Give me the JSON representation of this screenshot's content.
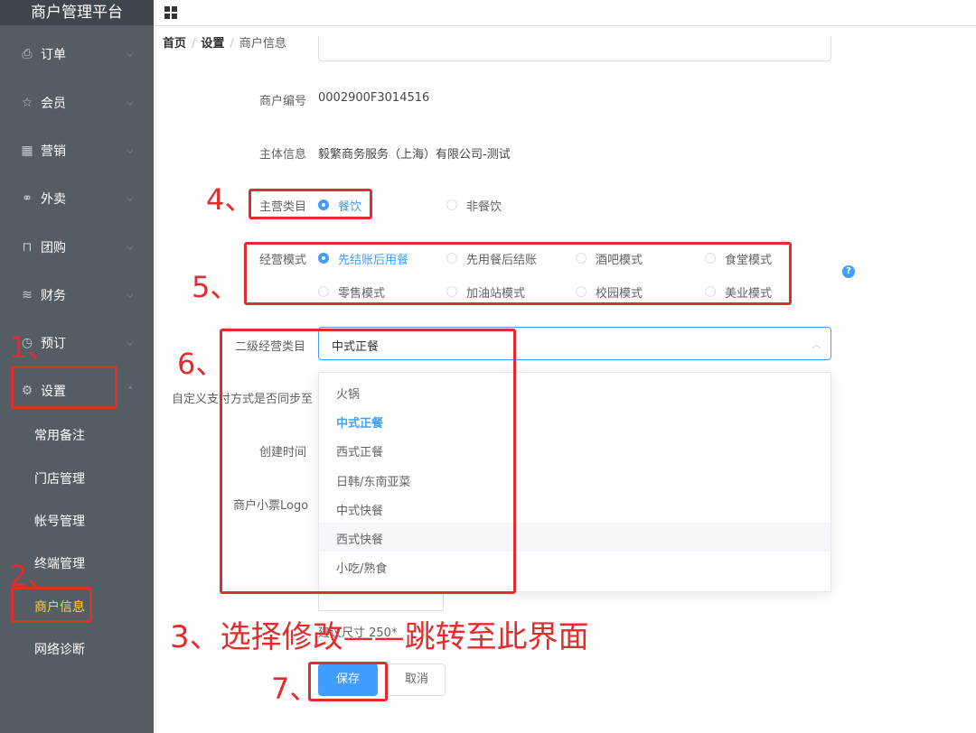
{
  "app": {
    "title": "商户管理平台"
  },
  "sidebar": {
    "menus": [
      {
        "label": "订单",
        "icon": "printer-icon"
      },
      {
        "label": "会员",
        "icon": "star-icon"
      },
      {
        "label": "营销",
        "icon": "grid-icon"
      },
      {
        "label": "外卖",
        "icon": "bike-icon"
      },
      {
        "label": "团购",
        "icon": "bag-icon"
      },
      {
        "label": "财务",
        "icon": "database-icon"
      },
      {
        "label": "预订",
        "icon": "clock-icon"
      },
      {
        "label": "设置",
        "icon": "gear-icon"
      }
    ],
    "sub_items": [
      {
        "label": "常用备注"
      },
      {
        "label": "门店管理"
      },
      {
        "label": "帐号管理"
      },
      {
        "label": "终端管理"
      },
      {
        "label": "商户信息"
      },
      {
        "label": "网络诊断"
      }
    ],
    "accent_color": "#ffd04b"
  },
  "breadcrumb": {
    "home": "首页",
    "settings": "设置",
    "current": "商户信息",
    "sep": "/"
  },
  "form": {
    "merchant_no_label": "商户编号",
    "merchant_no": "0002900F3014516",
    "entity_label": "主体信息",
    "entity": "毅繁商务服务（上海）有限公司-测试",
    "main_category_label": "主营类目",
    "main_categories": [
      "餐饮",
      "非餐饮"
    ],
    "mode_label": "经营模式",
    "modes": [
      "先结账后用餐",
      "先用餐后结账",
      "酒吧模式",
      "食堂模式",
      "零售模式",
      "加油站模式",
      "校园模式",
      "美业模式"
    ],
    "help_icon": "?",
    "sub_category_label": "二级经营类目",
    "sub_category_value": "中式正餐",
    "sub_category_options": [
      "火锅",
      "中式正餐",
      "西式正餐",
      "日韩/东南亚菜",
      "中式快餐",
      "西式快餐",
      "小吃/熟食"
    ],
    "custom_pay_label": "自定义支付方式是否同步至",
    "created_label": "创建时间",
    "logo_label": "商户小票Logo",
    "logo_hint": "建议尺寸 250*",
    "save_label": "保存",
    "cancel_label": "取消"
  },
  "annotations": {
    "n1": "1、",
    "n2": "2、",
    "n3": "3、",
    "n4": "4、",
    "n5": "5、",
    "n6": "6、",
    "n7": "7、",
    "step3_text": "选择修改——跳转至此界面",
    "color": "#e02d2d"
  },
  "theme": {
    "primary": "#409eff",
    "sidebar_bg": "#545c64"
  }
}
